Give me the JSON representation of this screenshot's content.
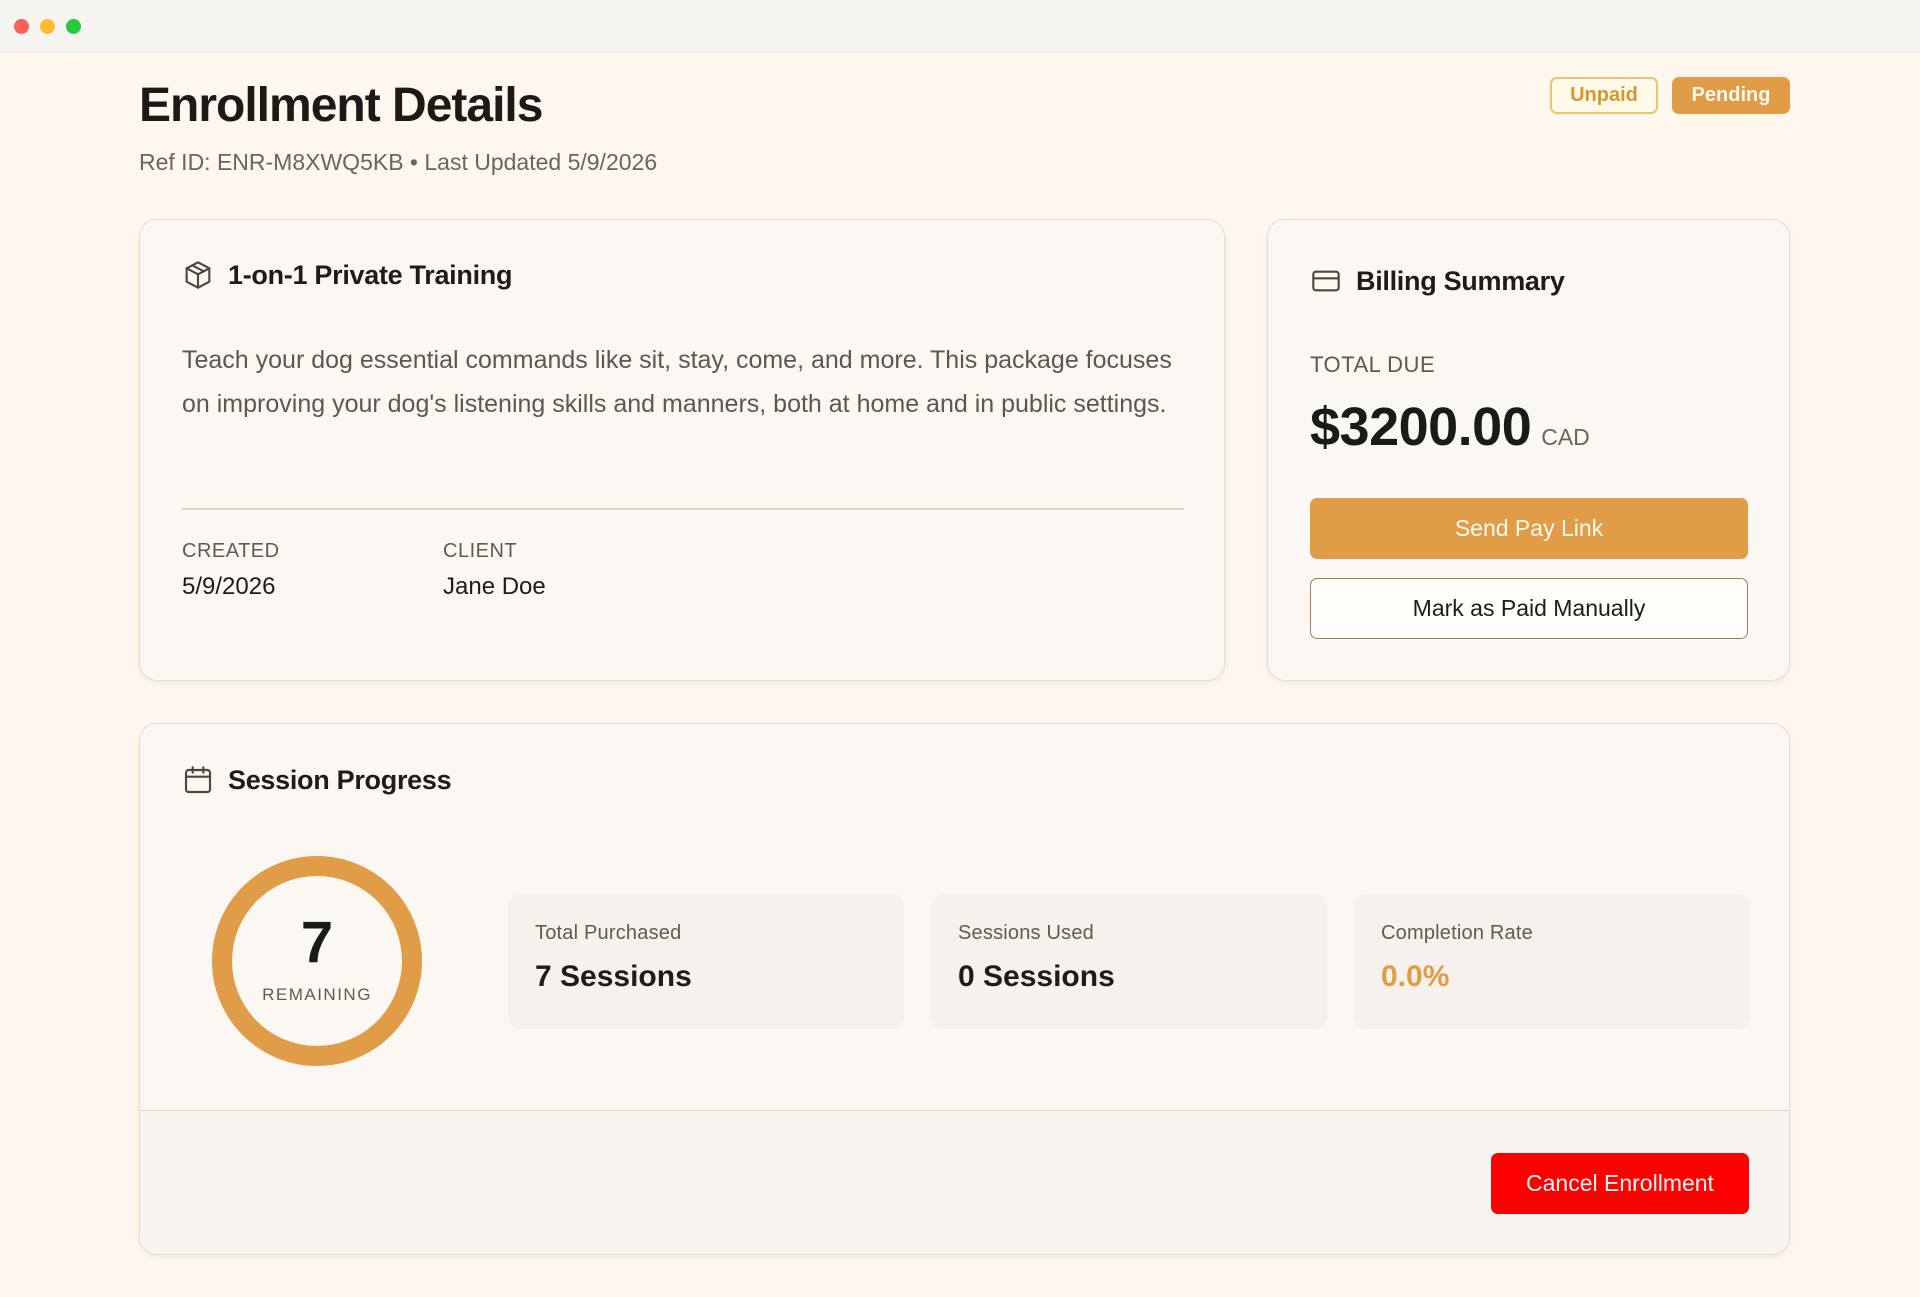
{
  "page": {
    "title": "Enrollment Details",
    "subtitle": "Ref ID: ENR-M8XWQ5KB • Last Updated 5/9/2026"
  },
  "badges": {
    "unpaid": "Unpaid",
    "pending": "Pending"
  },
  "program": {
    "title": "1-on-1 Private Training",
    "icon": "package-icon",
    "description": "Teach your dog essential commands like sit, stay, come, and more. This package focuses on improving your dog's listening skills and manners, both at home and in public settings.",
    "created_label": "CREATED",
    "created_value": "5/9/2026",
    "client_label": "CLIENT",
    "client_value": "Jane Doe"
  },
  "billing": {
    "title": "Billing Summary",
    "icon": "credit-card-icon",
    "total_due_label": "TOTAL DUE",
    "amount": "$3200.00",
    "currency": "CAD",
    "send_pay_link": "Send Pay Link",
    "mark_paid": "Mark as Paid Manually"
  },
  "sessions": {
    "title": "Session Progress",
    "icon": "calendar-icon",
    "remaining_count": "7",
    "remaining_label": "REMAINING",
    "remaining_fraction": 1.0,
    "stats": [
      {
        "label": "Total Purchased",
        "value": "7 Sessions"
      },
      {
        "label": "Sessions Used",
        "value": "0 Sessions"
      },
      {
        "label": "Completion Rate",
        "value": "0.0%"
      }
    ],
    "cancel": "Cancel Enrollment"
  },
  "colors": {
    "accent": "#e09c46",
    "danger": "#ff0000",
    "background": "#fdf7ed"
  }
}
